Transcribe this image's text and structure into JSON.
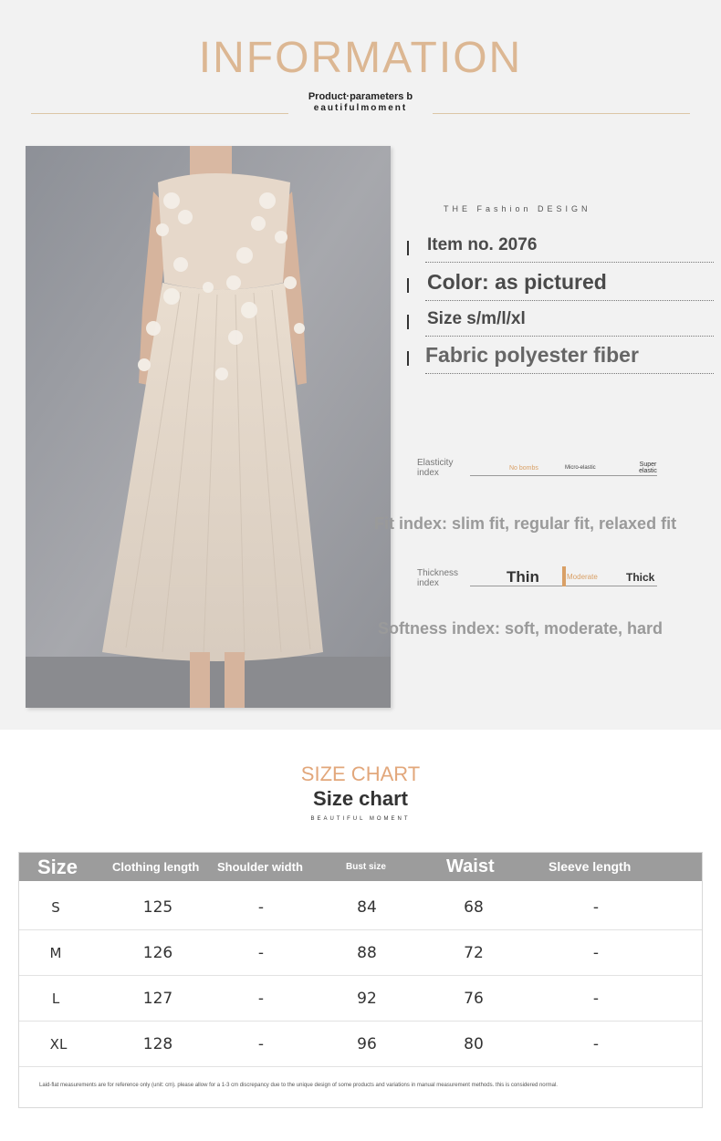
{
  "info": {
    "title": "INFORMATION",
    "subtitle_line1": "Product·parameters b",
    "subtitle_line2": "eautifulmoment",
    "fashion_label": "THE Fashion DESIGN",
    "params": [
      {
        "text": "Item no. 2076"
      },
      {
        "text": "Color: as pictured"
      },
      {
        "text": "Size s/m/l/xl"
      },
      {
        "text": "Fabric polyester fiber"
      }
    ],
    "elasticity": {
      "label_line1": "Elasticity",
      "label_line2": "index",
      "options": [
        "No bombs",
        "Micro-elastic",
        "Super elastic"
      ],
      "selected": "No bombs"
    },
    "fit_index": "Fit index: slim fit, regular fit, relaxed fit",
    "thickness": {
      "label_line1": "Thickness",
      "label_line2": "index",
      "options": [
        "Thin",
        "Moderate",
        "Thick"
      ],
      "selected": "Moderate"
    },
    "softness_index": "Softness index: soft, moderate, hard"
  },
  "size_chart": {
    "title": "SIZE CHART",
    "subtitle": "Size chart",
    "tagline": "BEAUTIFUL MOMENT",
    "headers": [
      "Size",
      "Clothing length",
      "Shoulder width",
      "Bust size",
      "Waist",
      "Sleeve length"
    ],
    "rows": [
      [
        "S",
        "125",
        "-",
        "84",
        "68",
        "-"
      ],
      [
        "M",
        "126",
        "-",
        "88",
        "72",
        "-"
      ],
      [
        "L",
        "127",
        "-",
        "92",
        "76",
        "-"
      ],
      [
        "XL",
        "128",
        "-",
        "96",
        "80",
        "-"
      ]
    ],
    "note": "Laid-flat measurements are for reference only (unit: cm). please allow for a 1-3 cm discrepancy due to the unique design of some products and variations in manual measurement methods. this is considered normal."
  },
  "colors": {
    "accent_gold": "#dcb793",
    "size_chart_orange": "#e2a77b",
    "table_header_gray": "#9c9c9c",
    "selected_tab": "#d9a066"
  }
}
